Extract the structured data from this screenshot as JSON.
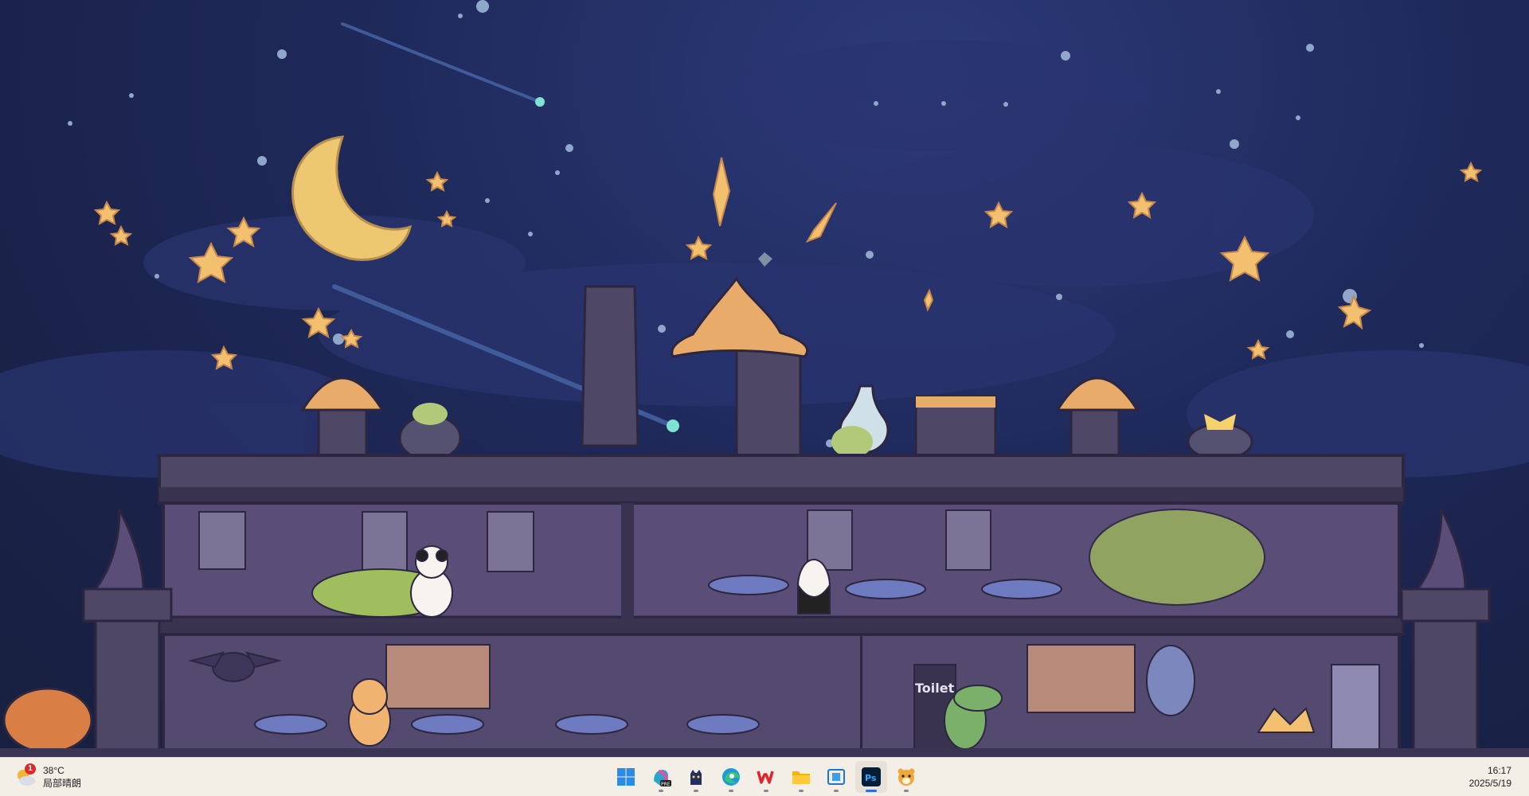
{
  "desktop": {
    "wallpaper": "Haunted castle dollhouse under starry night sky",
    "door_sign": "Toilet"
  },
  "taskbar": {
    "weather": {
      "badge": "1",
      "temperature": "38°C",
      "condition": "局部晴朗"
    },
    "apps": [
      {
        "name": "start",
        "icon": "windows-logo"
      },
      {
        "name": "copilot",
        "icon": "copilot-icon",
        "label": "PRE"
      },
      {
        "name": "cat-app",
        "icon": "black-cat-icon"
      },
      {
        "name": "edge",
        "icon": "edge-browser-icon"
      },
      {
        "name": "wps",
        "icon": "wps-office-icon"
      },
      {
        "name": "file-explorer",
        "icon": "folder-icon"
      },
      {
        "name": "task-view",
        "icon": "window-icon"
      },
      {
        "name": "photoshop",
        "icon": "photoshop-icon",
        "label": "Ps"
      },
      {
        "name": "pet-app",
        "icon": "tiger-face-icon"
      }
    ],
    "clock": {
      "time": "16:17",
      "date": "2025/5/19"
    }
  },
  "colors": {
    "sky": "#1f2a5c",
    "castle": "#4e4766",
    "castle_dark": "#39334f",
    "star": "#f2c06f",
    "taskbar": "#f3eee6"
  }
}
